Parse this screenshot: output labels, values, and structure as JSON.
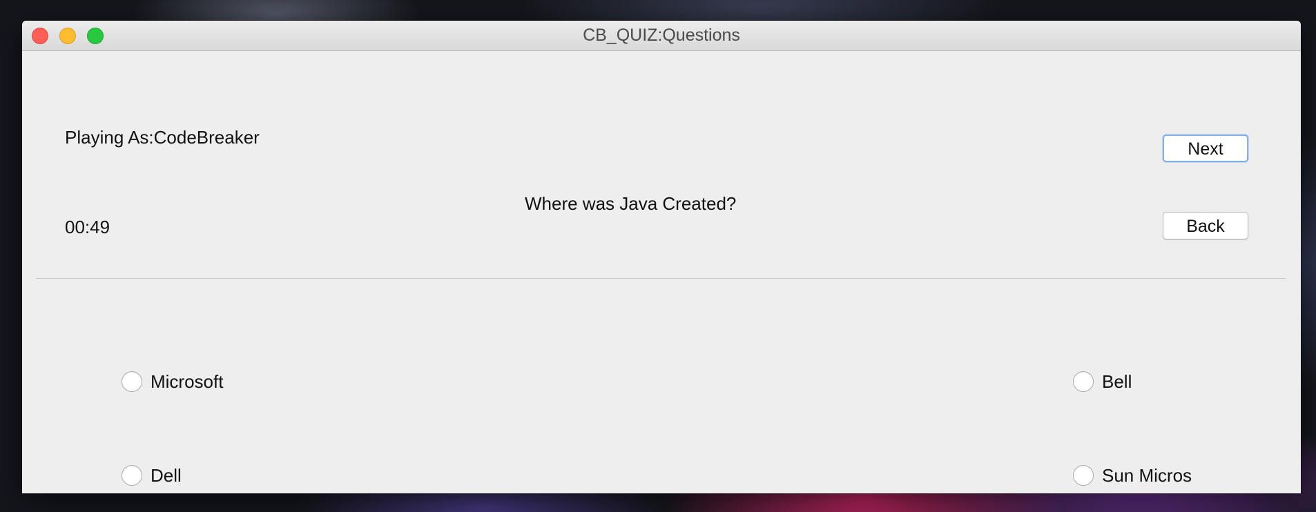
{
  "window": {
    "title": "CB_QUIZ:Questions"
  },
  "traffic_lights": {
    "close_color": "#fd5f57",
    "minimize_color": "#febc2e",
    "zoom_color": "#28c840"
  },
  "quiz": {
    "player_label": "Playing As:CodeBreaker",
    "timer": "00:49",
    "question": "Where was Java Created?",
    "next_label": "Next",
    "back_label": "Back",
    "options": [
      {
        "label": "Microsoft",
        "selected": false
      },
      {
        "label": "Bell",
        "selected": false
      },
      {
        "label": "Dell",
        "selected": false
      },
      {
        "label": "Sun Micros",
        "selected": false
      }
    ]
  }
}
